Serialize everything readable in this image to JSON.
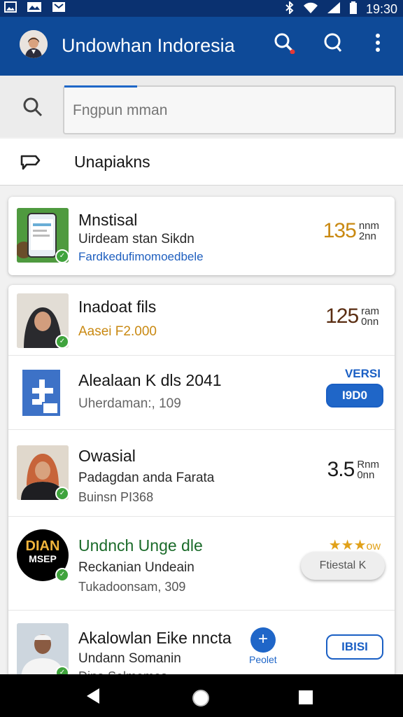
{
  "status_bar": {
    "time": "19:30"
  },
  "app_bar": {
    "title": "Undowhan Indoresia"
  },
  "search": {
    "placeholder": "Fngpun mman"
  },
  "filter": {
    "label": "Unapiakns"
  },
  "colors": {
    "primary": "#0e4a98",
    "status": "#0a3170",
    "accent_blue": "#1f66c8",
    "price_orange": "#c98912",
    "green_badge": "#3fa33c"
  },
  "listings": [
    {
      "title": "Mnstisal",
      "subtitle": "Uirdeam stan Sikdn",
      "link": "Fardkedufimomoedbele",
      "price": "135",
      "price_unit_top": "nnm",
      "price_unit_bottom": "2nn",
      "thumb_icon": "phone-app-thumbnail"
    },
    {
      "title": "Inadoat fils",
      "subtitle": "Aasei F2.000",
      "price": "125",
      "price_unit_top": "ram",
      "price_unit_bottom": "0nn",
      "thumb_icon": "woman-hijab-photo"
    },
    {
      "title": "Alealaan K dls 2041",
      "subtitle": "Uherdaman:, 109",
      "badge_label": "VERSI",
      "button_label": "I9D0",
      "thumb_icon": "blue-app-logo"
    },
    {
      "title": "Owasial",
      "subtitle": "Padagdan anda Farata",
      "meta": "Buinsn PI368",
      "price": "3.5",
      "price_unit_top": "Rnm",
      "price_unit_bottom": "0nn",
      "thumb_icon": "woman-orange-hijab-photo"
    },
    {
      "title": "Undnch Unge dle",
      "subtitle": "Reckanian Undeain",
      "meta": "Tukadoonsam, 309",
      "rating": "★★★",
      "rating_suffix": "ow",
      "button_label": "Ftiestal K",
      "logo_lines": [
        "DIAN",
        "MSEP"
      ],
      "thumb_icon": "brand-logo"
    },
    {
      "title": "Akalowlan Eike nncta",
      "subtitle": "Undann Somanin",
      "meta": "Dina Selmemes",
      "fab_label": "Peolet",
      "button_label": "IBISI",
      "thumb_icon": "man-photo"
    }
  ]
}
